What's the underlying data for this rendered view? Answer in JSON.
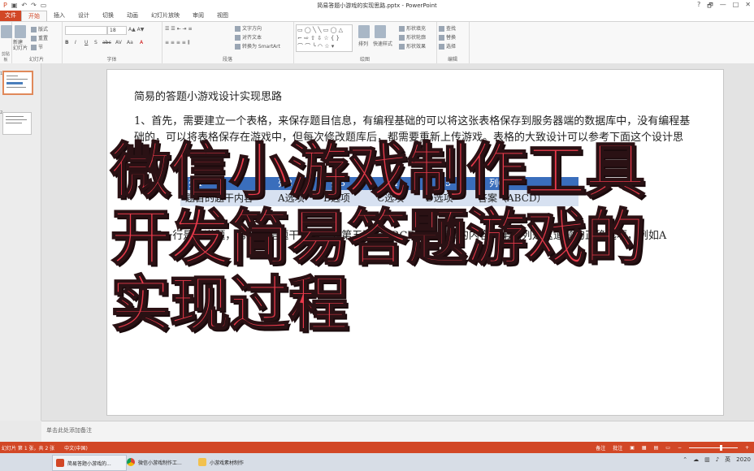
{
  "window": {
    "title": "简易答题小游戏的实现思路.pptx - PowerPoint",
    "help": "?",
    "restore": "🗗",
    "minimize": "—",
    "maximize": "□",
    "close": "✕"
  },
  "tabs": [
    "文件",
    "开始",
    "插入",
    "设计",
    "切换",
    "动画",
    "幻灯片放映",
    "审阅",
    "视图"
  ],
  "ribbon": {
    "clipboard_label": "剪贴板",
    "slides_label": "幻灯片",
    "new_slide": "新建\n幻灯片",
    "layout": "版式",
    "reset": "重置",
    "section": "节",
    "font_label": "字体",
    "font_size": "18",
    "bold": "B",
    "italic": "I",
    "underline": "U",
    "strike": "S",
    "shadow": "abc",
    "spacing": "AV",
    "case": "Aa",
    "paragraph_label": "段落",
    "text_direction": "文字方向",
    "align_text": "对齐文本",
    "smartart": "转换为 SmartArt",
    "drawing_label": "绘图",
    "arrange": "排列",
    "quick_styles": "快速样式",
    "shape_fill": "形状填充",
    "shape_outline": "形状轮廓",
    "shape_effects": "形状效果",
    "editing_label": "编辑",
    "find": "查找",
    "replace": "替换",
    "select": "选择"
  },
  "thumbnails": [
    {
      "num": "1"
    },
    {
      "num": "2"
    }
  ],
  "slide": {
    "title": "简易的答题小游戏设计实现思路",
    "para1": "1、首先，需要建立一个表格，来保存题目信息，有编程基础的可以将这张表格保存到服务器端的数据库中，没有编程基础的，可以将表格保存在游戏中，但每次修改题库后，都需要重新上传游戏。表格的大致设计可以参考下面这个设计思路：",
    "table_head": [
      "列1",
      "列2",
      "列3",
      "列4",
      "列5",
      "列6"
    ],
    "table_row": [
      "题目的题干内容",
      "A选项",
      "B选项",
      "C选项",
      "D选项",
      "答案（ABCD）"
    ],
    "para2": "2、每一行是一道题，第一列是题干，第二到第五列是ABCD四个选项的内容，第六列是这道题的正确选项，例如A"
  },
  "overlay": {
    "line1": "微信小游戏制作工具",
    "line2": "开发简易答题游戏的",
    "line3": "实现过程"
  },
  "notes": {
    "placeholder": "单击此处添加备注"
  },
  "status": {
    "slide_count": "幻灯片 第 1 张，共 2 张",
    "language": "中文(中国)",
    "notes_btn": "备注",
    "comments_btn": "批注",
    "zoom": "- +"
  },
  "taskbar": {
    "items": [
      {
        "label": "简易答题小游戏的..."
      },
      {
        "label": "微信小游戏制作工..."
      },
      {
        "label": "小游戏素材制作"
      }
    ],
    "clock": "2020"
  },
  "colors": {
    "accent": "#d24726",
    "table_header": "#3a6ebc",
    "table_row": "#d7e1f1",
    "overlay_text": "#e8394a"
  }
}
